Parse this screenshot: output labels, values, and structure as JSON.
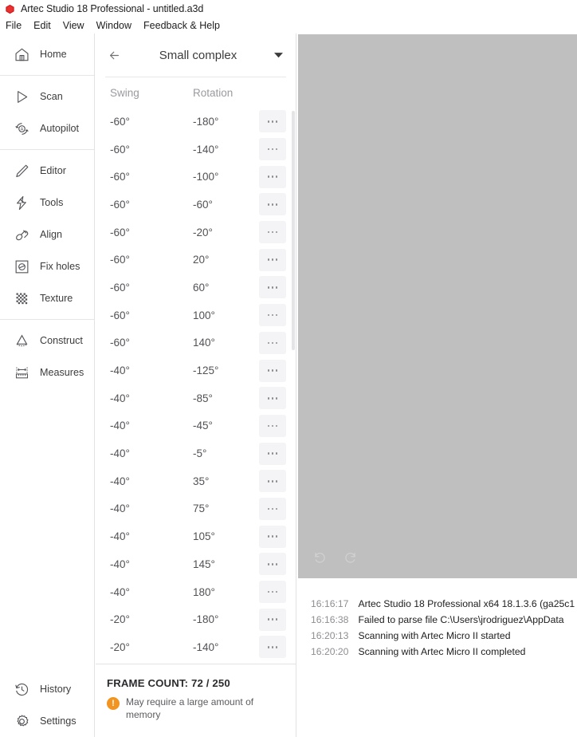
{
  "window": {
    "logo_icon": "artec-hexagon-logo",
    "title": "Artec Studio 18 Professional - untitled.a3d"
  },
  "menubar": {
    "items": [
      {
        "label": "File"
      },
      {
        "label": "Edit"
      },
      {
        "label": "View"
      },
      {
        "label": "Window"
      },
      {
        "label": "Feedback & Help"
      }
    ]
  },
  "sidebar": {
    "groups": [
      {
        "items": [
          {
            "label": "Home",
            "icon": "home-icon"
          }
        ]
      },
      {
        "items": [
          {
            "label": "Scan",
            "icon": "play-triangle-icon"
          },
          {
            "label": "Autopilot",
            "icon": "autopilot-icon"
          }
        ]
      },
      {
        "items": [
          {
            "label": "Editor",
            "icon": "pencil-icon"
          },
          {
            "label": "Tools",
            "icon": "lightning-icon"
          },
          {
            "label": "Align",
            "icon": "align-icon"
          },
          {
            "label": "Fix holes",
            "icon": "fix-holes-icon"
          },
          {
            "label": "Texture",
            "icon": "texture-checker-icon"
          }
        ]
      },
      {
        "items": [
          {
            "label": "Construct",
            "icon": "cone-icon"
          },
          {
            "label": "Measures",
            "icon": "ruler-icon"
          }
        ]
      }
    ],
    "bottom_items": [
      {
        "label": "History",
        "icon": "history-clock-icon"
      },
      {
        "label": "Settings",
        "icon": "gear-icon"
      }
    ]
  },
  "panel": {
    "back_icon": "arrow-left-icon",
    "title": "Small complex",
    "dropdown_icon": "chevron-down-icon",
    "columns": [
      "Swing",
      "Rotation"
    ],
    "row_menu_icon": "ellipsis-icon",
    "rows": [
      {
        "swing": "-60°",
        "rotation": "-180°"
      },
      {
        "swing": "-60°",
        "rotation": "-140°"
      },
      {
        "swing": "-60°",
        "rotation": "-100°"
      },
      {
        "swing": "-60°",
        "rotation": "-60°"
      },
      {
        "swing": "-60°",
        "rotation": "-20°"
      },
      {
        "swing": "-60°",
        "rotation": "20°"
      },
      {
        "swing": "-60°",
        "rotation": "60°"
      },
      {
        "swing": "-60°",
        "rotation": "100°"
      },
      {
        "swing": "-60°",
        "rotation": "140°"
      },
      {
        "swing": "-40°",
        "rotation": "-125°"
      },
      {
        "swing": "-40°",
        "rotation": "-85°"
      },
      {
        "swing": "-40°",
        "rotation": "-45°"
      },
      {
        "swing": "-40°",
        "rotation": "-5°"
      },
      {
        "swing": "-40°",
        "rotation": "35°"
      },
      {
        "swing": "-40°",
        "rotation": "75°"
      },
      {
        "swing": "-40°",
        "rotation": "105°"
      },
      {
        "swing": "-40°",
        "rotation": "145°"
      },
      {
        "swing": "-40°",
        "rotation": "180°"
      },
      {
        "swing": "-20°",
        "rotation": "-180°"
      },
      {
        "swing": "-20°",
        "rotation": "-140°"
      }
    ],
    "footer": {
      "frame_count_label": "FRAME COUNT: 72 / 250",
      "warning_icon": "warning-exclamation-icon",
      "warning_text": "May require a large amount of memory",
      "warning_color": "#f2941f"
    }
  },
  "viewport": {
    "background_color": "#bfbfbf",
    "tools": [
      {
        "icon": "undo-icon"
      },
      {
        "icon": "redo-icon"
      }
    ]
  },
  "log": {
    "entries": [
      {
        "time": "16:16:17",
        "message": "Artec Studio 18 Professional x64 18.1.3.6 (ga25c1"
      },
      {
        "time": "16:16:38",
        "message": "Failed to parse file C:\\Users\\jrodriguez\\AppData"
      },
      {
        "time": "16:20:13",
        "message": "Scanning with Artec Micro II started"
      },
      {
        "time": "16:20:20",
        "message": "Scanning with Artec Micro II completed"
      }
    ]
  }
}
